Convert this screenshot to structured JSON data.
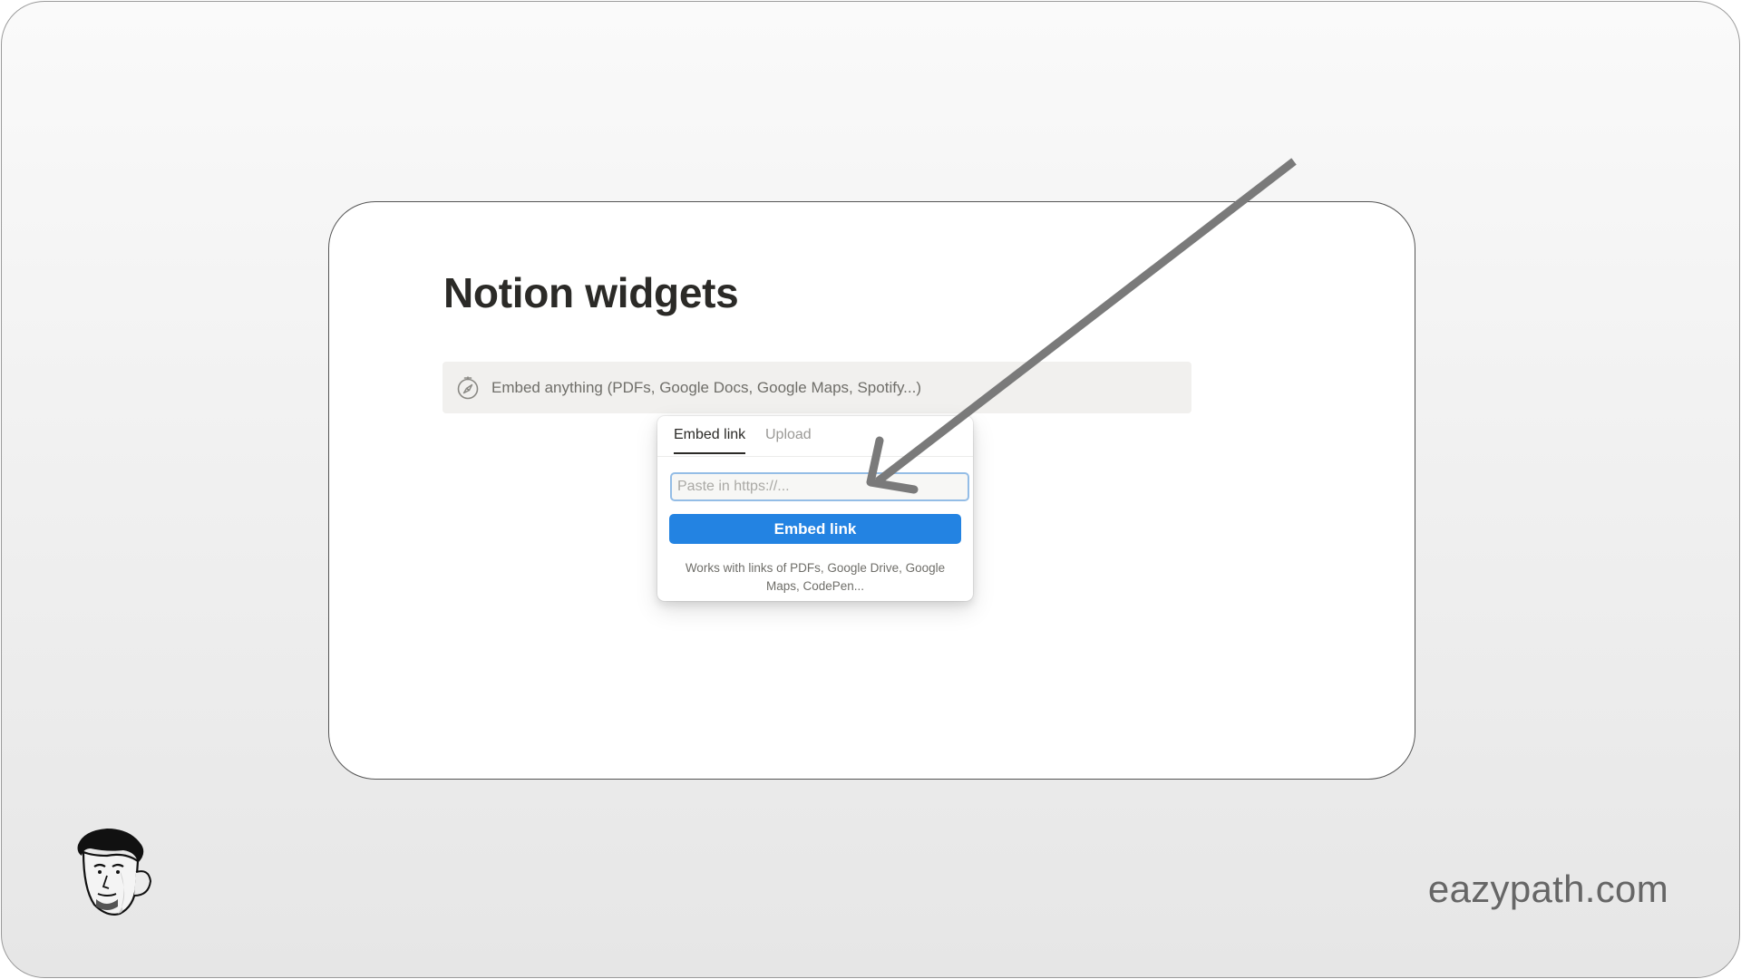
{
  "page": {
    "title": "Notion widgets"
  },
  "embed_block": {
    "icon": "compass-icon",
    "hint": "Embed anything (PDFs, Google Docs, Google Maps, Spotify...)"
  },
  "popover": {
    "tabs": [
      {
        "label": "Embed link",
        "active": true
      },
      {
        "label": "Upload",
        "active": false
      }
    ],
    "url_input": {
      "value": "",
      "placeholder": "Paste in https://..."
    },
    "embed_button_label": "Embed link",
    "helper_text": "Works with links of PDFs, Google Drive, Google Maps, CodePen..."
  },
  "overlay": {
    "arrow_icon": "pointer-arrow-icon",
    "avatar_icon": "avatar-illustration",
    "site_label": "eazypath.com"
  },
  "colors": {
    "accent": "#2383e2",
    "input_focus": "#94bde6",
    "embed_block_bg": "#f1f0ee",
    "arrow": "#7a7a7a"
  }
}
